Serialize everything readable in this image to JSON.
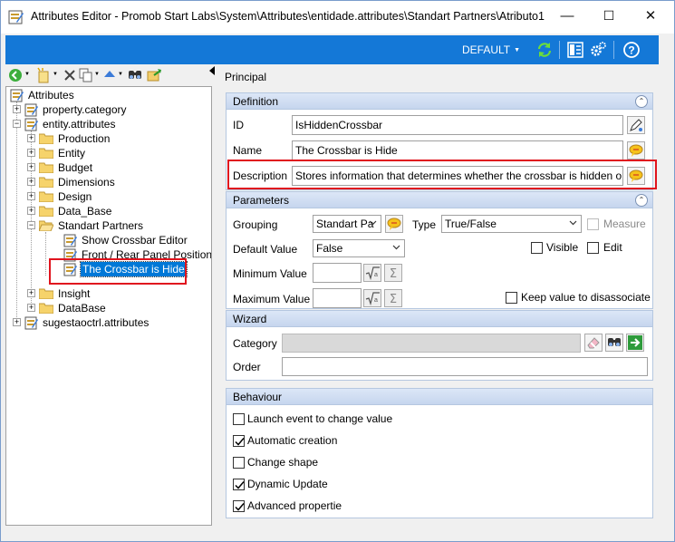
{
  "window": {
    "title": "Attributes Editor - Promob Start Labs\\System\\Attributes\\entidade.attributes\\Standart Partners\\Atributo1",
    "minimize": "—",
    "maximize": "☐",
    "close": "✕"
  },
  "bluebar": {
    "default_label": "DEFAULT",
    "accent": "#1478d7"
  },
  "tree": {
    "root": "Attributes",
    "n1": "property.category",
    "n2": "entity.attributes",
    "n3": "Production",
    "n4": "Entity",
    "n5": "Budget",
    "n6": "Dimensions",
    "n7": "Design",
    "n8": "Data_Base",
    "n9": "Standart Partners",
    "n10": "Show Crossbar Editor",
    "n11": "Front / Rear Panel Position",
    "n12": "The Crossbar is Hide",
    "n13": "Insight",
    "n14": "DataBase",
    "n15": "sugestaoctrl.attributes"
  },
  "principal": "Principal",
  "definition": {
    "header": "Definition",
    "id_label": "ID",
    "id_value": "IsHiddenCrossbar",
    "name_label": "Name",
    "name_value": "The Crossbar is Hide",
    "desc_label": "Description",
    "desc_value": "Stores information that determines whether the crossbar is hidden or not"
  },
  "parameters": {
    "header": "Parameters",
    "grouping_label": "Grouping",
    "grouping_value": "Standart Pa",
    "type_label": "Type",
    "type_value": "True/False",
    "measure_label": "Measure",
    "default_label": "Default Value",
    "default_value": "False",
    "visible_label": "Visible",
    "edit_label": "Edit",
    "min_label": "Minimum Value",
    "max_label": "Maximum Value",
    "keep_label": "Keep value to disassociate"
  },
  "wizard": {
    "header": "Wizard",
    "category_label": "Category",
    "order_label": "Order"
  },
  "behaviour": {
    "header": "Behaviour",
    "opt1": "Launch event to change value",
    "opt2": "Automatic creation",
    "opt3": "Change shape",
    "opt4": "Dynamic Update",
    "opt5": "Advanced propertie",
    "checked": [
      false,
      true,
      false,
      true,
      true
    ]
  },
  "highlight_color": "#e0141e"
}
